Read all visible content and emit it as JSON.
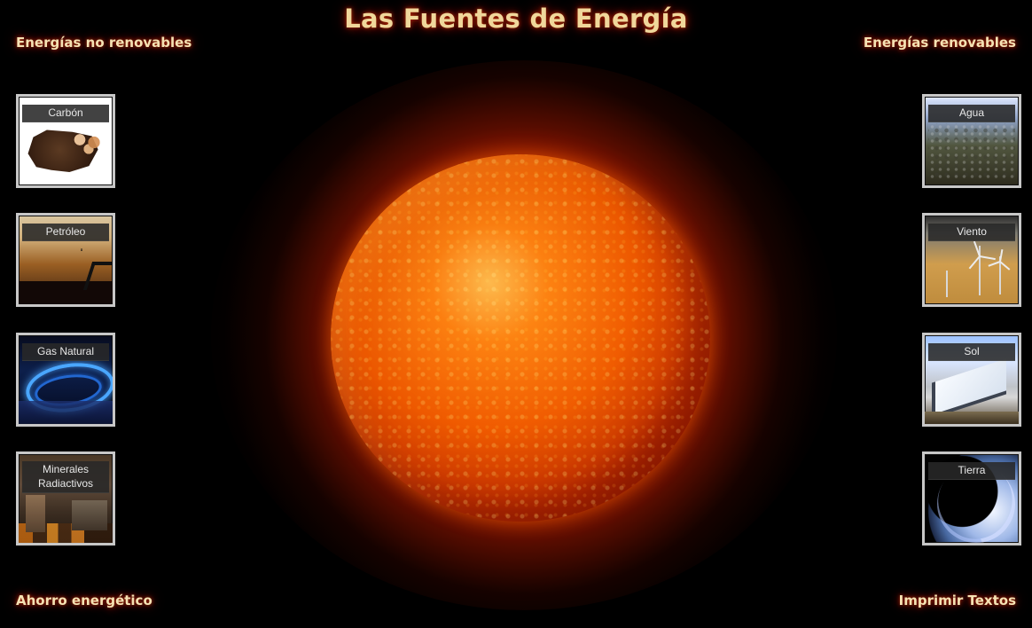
{
  "header": {
    "title": "Las Fuentes de Energía",
    "left_link": "Energías no renovables",
    "right_link": "Energías renovables"
  },
  "tiles": {
    "left": [
      {
        "label": "Carbón",
        "icon": "coal-icon"
      },
      {
        "label": "Petróleo",
        "icon": "oil-icon"
      },
      {
        "label": "Gas Natural",
        "icon": "gas-icon"
      },
      {
        "label": "Minerales\nRadiactivos",
        "icon": "minerals-icon"
      }
    ],
    "right": [
      {
        "label": "Agua",
        "icon": "water-icon"
      },
      {
        "label": "Viento",
        "icon": "wind-icon"
      },
      {
        "label": "Sol",
        "icon": "sun-panel-icon"
      },
      {
        "label": "Tierra",
        "icon": "earth-icon"
      }
    ]
  },
  "footer": {
    "left_link": "Ahorro energético",
    "right_link": "Imprimir Textos"
  },
  "colors": {
    "background": "#000000",
    "title_text": "#f0d79b",
    "title_glow": "#b42800",
    "sun_outer": "#ff5200",
    "sun_inner": "#ffb64a",
    "tile_border": "#c7c7c7",
    "tile_label_bg": "#282828"
  }
}
